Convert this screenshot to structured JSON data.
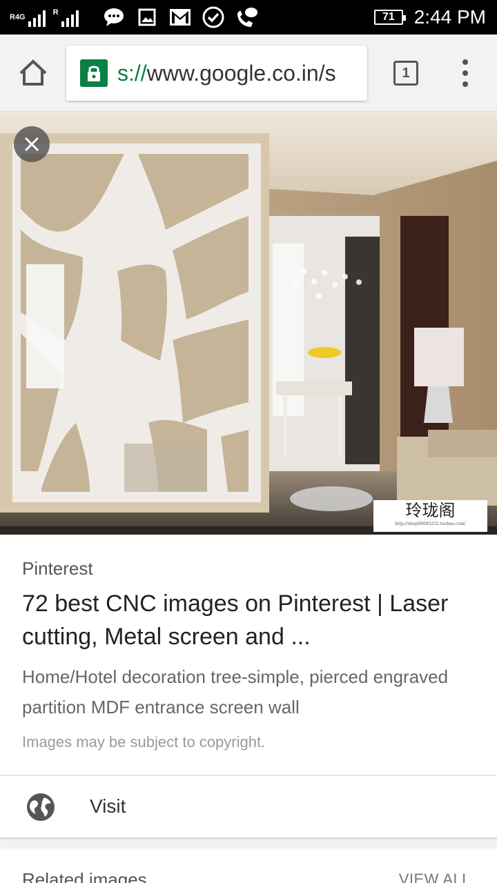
{
  "status_bar": {
    "network": "R4G",
    "roaming": "R",
    "battery": "71",
    "time": "2:44 PM",
    "icons": [
      "message-icon",
      "image-icon",
      "gmail-icon",
      "check-circle-icon",
      "missed-call-icon"
    ]
  },
  "toolbar": {
    "url_scheme": "s://",
    "url_rest": "www.google.co.in/s",
    "tab_count": "1"
  },
  "image": {
    "watermark_chars": "玲珑阁",
    "watermark_url": "http://shop66085252.taobao.com/"
  },
  "result": {
    "source": "Pinterest",
    "title": "72 best CNC images on Pinterest | Laser cutting, Metal screen and ...",
    "description": "Home/Hotel decoration tree-simple, pierced engraved partition MDF entrance screen wall",
    "copyright": "Images may be subject to copyright."
  },
  "visit": {
    "label": "Visit"
  },
  "related": {
    "label": "Related images",
    "view_all": "VIEW ALL"
  },
  "colors": {
    "secure_green": "#0b8043",
    "status_bar": "#000000"
  }
}
